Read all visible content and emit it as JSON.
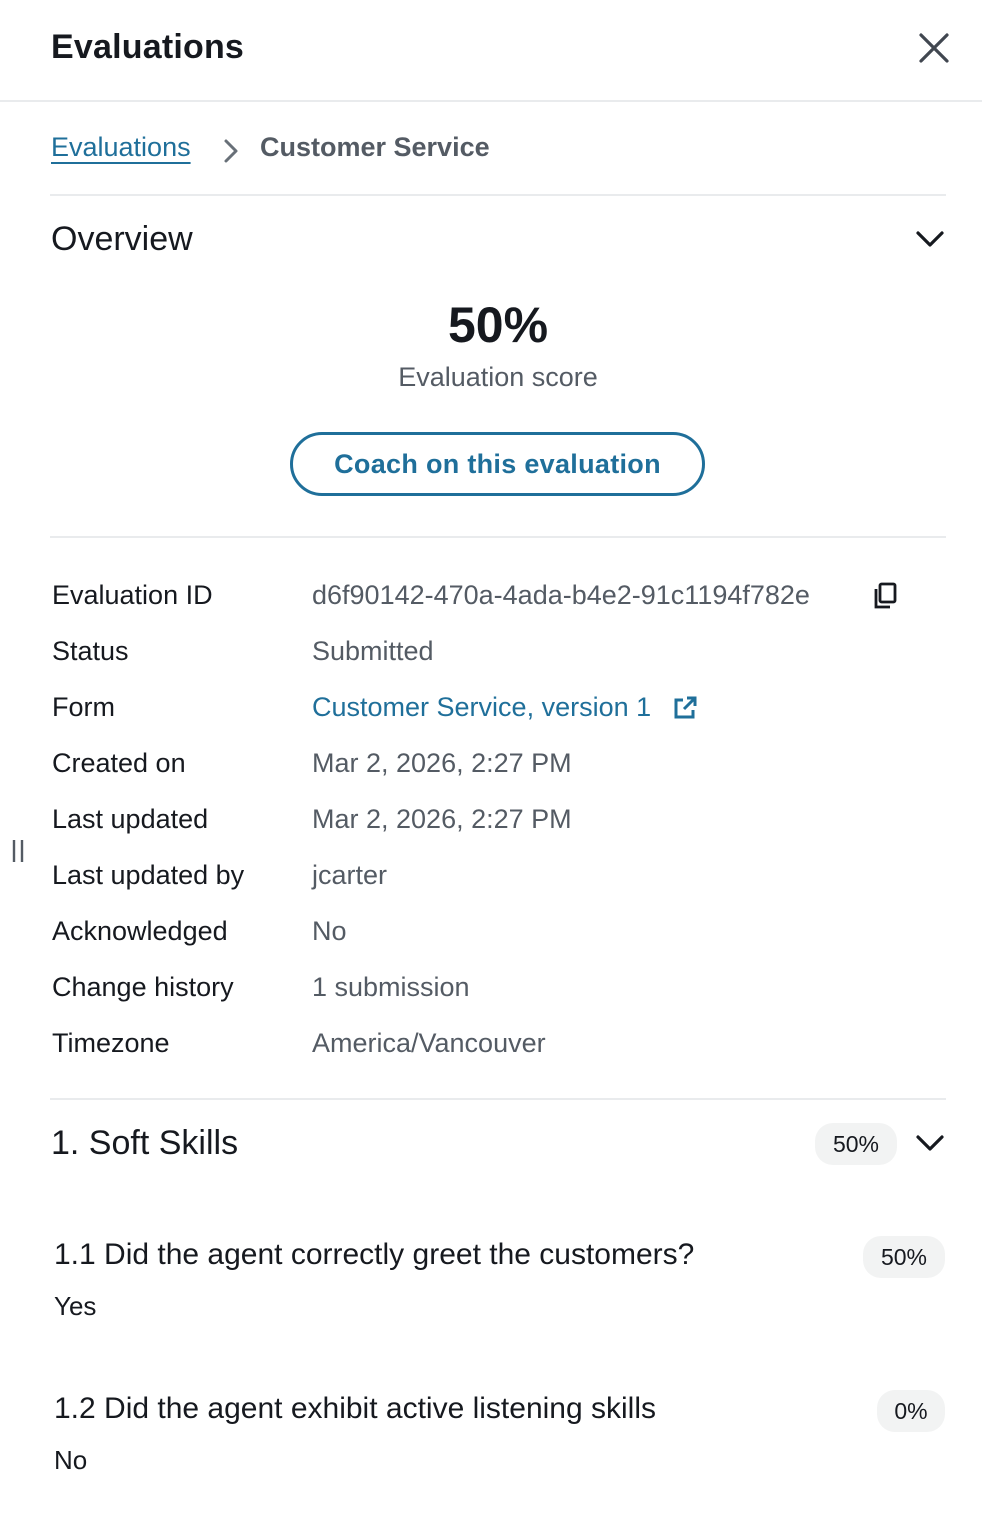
{
  "header": {
    "title": "Evaluations"
  },
  "breadcrumb": {
    "parent": "Evaluations",
    "current": "Customer Service"
  },
  "overview": {
    "title": "Overview",
    "score": "50%",
    "score_label": "Evaluation score",
    "coach_button": "Coach on this evaluation"
  },
  "details": [
    {
      "label": "Evaluation ID",
      "value": "d6f90142-470a-4ada-b4e2-91c1194f782e"
    },
    {
      "label": "Status",
      "value": "Submitted"
    },
    {
      "label": "Form",
      "value": "Customer Service, version 1"
    },
    {
      "label": "Created on",
      "value": "Mar 2, 2026, 2:27 PM"
    },
    {
      "label": "Last updated",
      "value": "Mar 2, 2026, 2:27 PM"
    },
    {
      "label": "Last updated by",
      "value": "jcarter"
    },
    {
      "label": "Acknowledged",
      "value": "No"
    },
    {
      "label": "Change history",
      "value": "1 submission"
    },
    {
      "label": "Timezone",
      "value": "America/Vancouver"
    }
  ],
  "section": {
    "title": "1. Soft Skills",
    "score": "50%",
    "questions": [
      {
        "text": "1.1 Did the agent correctly greet the customers?",
        "answer": "Yes",
        "score": "50%"
      },
      {
        "text": "1.2 Did the agent exhibit active listening skills",
        "answer": "No",
        "score": "0%"
      }
    ]
  },
  "icons": {
    "close": "close-icon",
    "breadcrumb_separator": "chevron-right-icon",
    "collapse": "chevron-down-icon",
    "copy": "copy-icon",
    "external_link": "external-link-icon",
    "resize": "resize-handle-icon"
  },
  "colors": {
    "link": "#1f6f9a",
    "text": "#16191f",
    "muted": "#545b64",
    "divider": "#e9ebed",
    "badge_bg": "#f2f3f3"
  }
}
